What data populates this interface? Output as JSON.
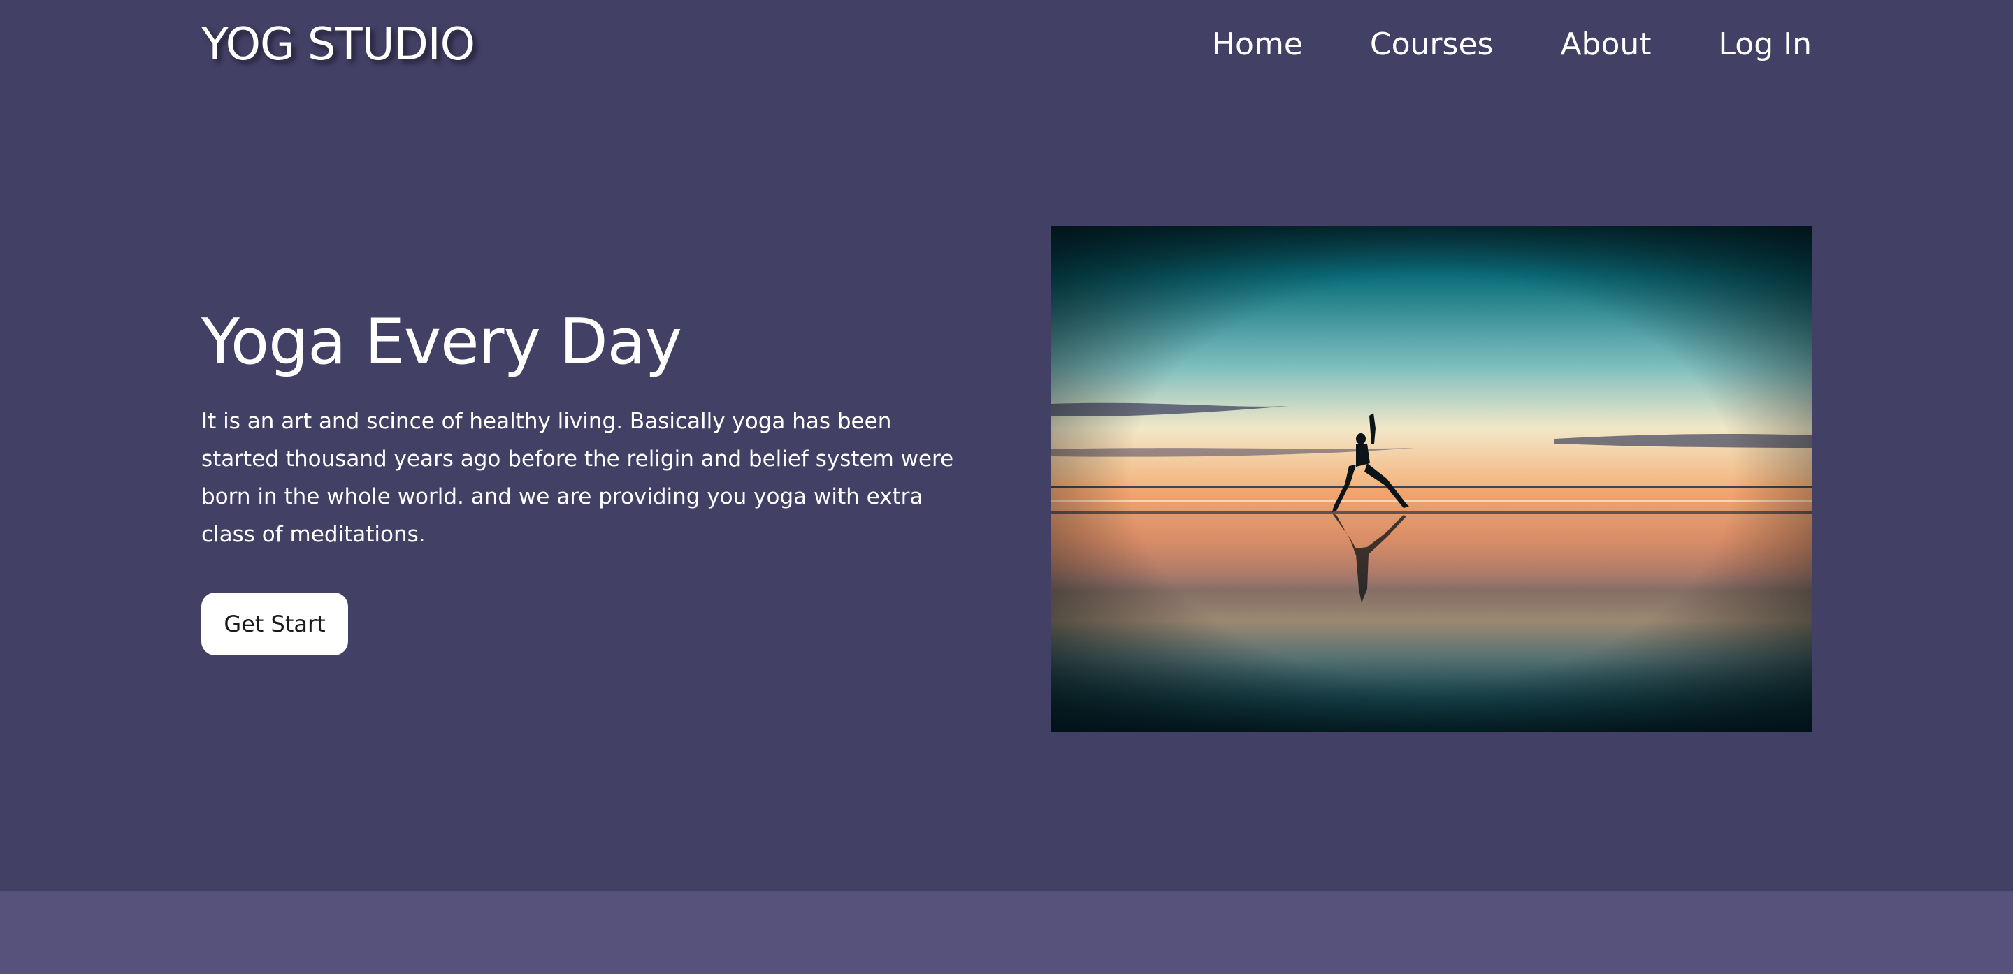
{
  "brand": {
    "name": "YOG STUDIO"
  },
  "nav": {
    "items": [
      {
        "label": "Home"
      },
      {
        "label": "Courses"
      },
      {
        "label": "About"
      },
      {
        "label": "Log In"
      }
    ]
  },
  "hero": {
    "title": "Yoga Every Day",
    "description": "It is an art and scince of healthy living. Basically yoga has been started thousand years ago before the religin and belief system were born in the whole world. and we are providing you yoga with extra class of meditations.",
    "button_label": "Get Start",
    "image": {
      "subject": "yoga-silhouette-sunset-beach-photo"
    }
  },
  "colors": {
    "background": "#434066",
    "footer_band": "#56527c",
    "text": "#ffffff",
    "button_bg": "#ffffff",
    "button_text": "#1a1a1a"
  }
}
